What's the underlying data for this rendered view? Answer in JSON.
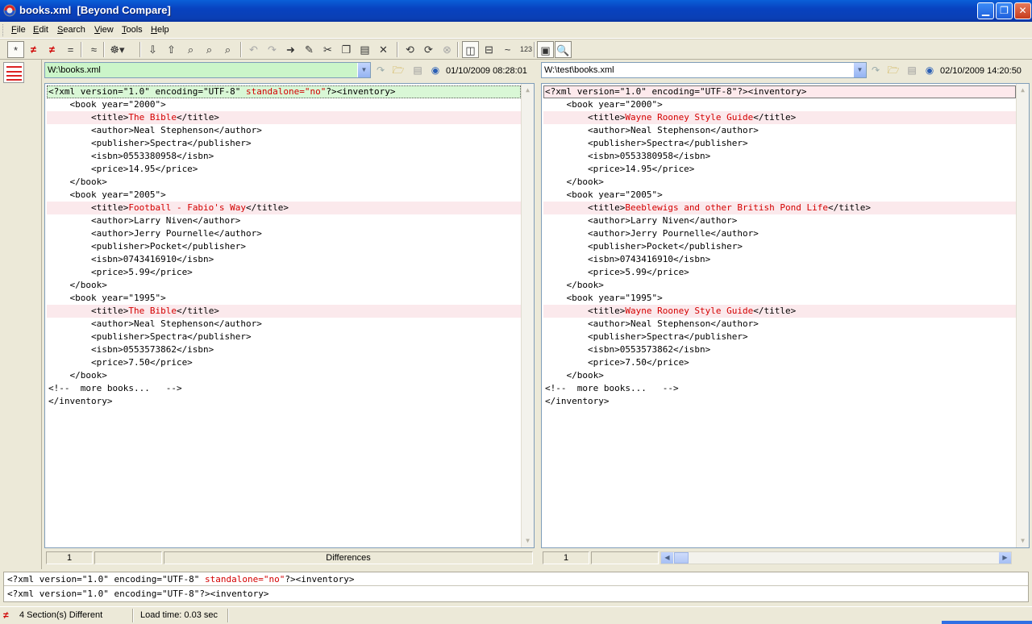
{
  "window": {
    "title": "books.xml  [Beyond Compare]",
    "minimize_glyph": "▁",
    "maximize_glyph": "❐",
    "close_glyph": "✕"
  },
  "menu": [
    "File",
    "Edit",
    "Search",
    "View",
    "Tools",
    "Help"
  ],
  "toolbar": {
    "buttons": [
      {
        "name": "show-all-button",
        "glyph": "*",
        "pressed": true
      },
      {
        "name": "show-differences-button",
        "glyph": "≠",
        "red": true
      },
      {
        "name": "show-diffs-context-button",
        "glyph": "≠",
        "red": true
      },
      {
        "name": "show-same-button",
        "glyph": "="
      },
      {
        "name": "ignore-unimportant-button",
        "glyph": "≈"
      },
      {
        "name": "rules-button",
        "glyph": "☸▾"
      },
      {
        "name": "next-difference-button",
        "glyph": "⇩"
      },
      {
        "name": "prev-difference-button",
        "glyph": "⇧"
      },
      {
        "name": "find-button",
        "glyph": "⌕"
      },
      {
        "name": "find-next-button",
        "glyph": "⌕"
      },
      {
        "name": "find-prev-button",
        "glyph": "⌕"
      },
      {
        "name": "undo-button",
        "glyph": "↶",
        "disabled": true
      },
      {
        "name": "redo-button",
        "glyph": "↷",
        "disabled": true
      },
      {
        "name": "copy-to-other-side-button",
        "glyph": "➜"
      },
      {
        "name": "edit-button",
        "glyph": "✎"
      },
      {
        "name": "cut-button",
        "glyph": "✂"
      },
      {
        "name": "copy-button",
        "glyph": "❐"
      },
      {
        "name": "paste-button",
        "glyph": "▤"
      },
      {
        "name": "delete-button",
        "glyph": "✕"
      },
      {
        "name": "swap-sides-button",
        "glyph": "⟲"
      },
      {
        "name": "refresh-button",
        "glyph": "⟳"
      },
      {
        "name": "stop-button",
        "glyph": "⊗",
        "disabled": true
      },
      {
        "name": "side-by-side-button",
        "glyph": "◫",
        "pressed": true
      },
      {
        "name": "over-under-button",
        "glyph": "⊟"
      },
      {
        "name": "whitespace-button",
        "glyph": "~"
      },
      {
        "name": "line-numbers-button",
        "glyph": "123",
        "small": true
      },
      {
        "name": "thumbnail-button",
        "glyph": "▣",
        "pressed": true
      },
      {
        "name": "zoom-button",
        "glyph": "🔍",
        "pressed": true
      }
    ]
  },
  "left": {
    "path": "W:\\books.xml",
    "timestamp": "01/10/2009 08:28:01",
    "status_line": "1",
    "status_label": "Differences",
    "lines": [
      [
        {
          "t": "<?xml version=\"1.0\" encoding=\"UTF-8\" "
        },
        {
          "t": "standalone=\"no\"",
          "r": true
        },
        {
          "t": "?><inventory>"
        }
      ],
      [
        {
          "t": "    <book year=\"2000\">"
        }
      ],
      [
        {
          "t": "        <title>"
        },
        {
          "t": "The Bible",
          "r": true
        },
        {
          "t": "</title>"
        }
      ],
      [
        {
          "t": "        <author>Neal Stephenson</author>"
        }
      ],
      [
        {
          "t": "        <publisher>Spectra</publisher>"
        }
      ],
      [
        {
          "t": "        <isbn>0553380958</isbn>"
        }
      ],
      [
        {
          "t": "        <price>14.95</price>"
        }
      ],
      [
        {
          "t": "    </book>"
        }
      ],
      [
        {
          "t": "    <book year=\"2005\">"
        }
      ],
      [
        {
          "t": "        <title>"
        },
        {
          "t": "Football - Fabio's Way",
          "r": true
        },
        {
          "t": "</title>"
        }
      ],
      [
        {
          "t": "        <author>Larry Niven</author>"
        }
      ],
      [
        {
          "t": "        <author>Jerry Pournelle</author>"
        }
      ],
      [
        {
          "t": "        <publisher>Pocket</publisher>"
        }
      ],
      [
        {
          "t": "        <isbn>0743416910</isbn>"
        }
      ],
      [
        {
          "t": "        <price>5.99</price>"
        }
      ],
      [
        {
          "t": "    </book>"
        }
      ],
      [
        {
          "t": "    <book year=\"1995\">"
        }
      ],
      [
        {
          "t": "        <title>"
        },
        {
          "t": "The Bible",
          "r": true
        },
        {
          "t": "</title>"
        }
      ],
      [
        {
          "t": "        <author>Neal Stephenson</author>"
        }
      ],
      [
        {
          "t": "        <publisher>Spectra</publisher>"
        }
      ],
      [
        {
          "t": "        <isbn>0553573862</isbn>"
        }
      ],
      [
        {
          "t": "        <price>7.50</price>"
        }
      ],
      [
        {
          "t": "    </book>"
        }
      ],
      [
        {
          "t": "<!--  more books...   -->"
        }
      ],
      [
        {
          "t": "</inventory>"
        }
      ]
    ]
  },
  "right": {
    "path": "W:\\test\\books.xml",
    "timestamp": "02/10/2009 14:20:50",
    "status_line": "1",
    "lines": [
      [
        {
          "t": "<?xml version=\"1.0\" encoding=\"UTF-8\"?><inventory>"
        }
      ],
      [
        {
          "t": "    <book year=\"2000\">"
        }
      ],
      [
        {
          "t": "        <title>"
        },
        {
          "t": "Wayne Rooney Style Guide",
          "r": true
        },
        {
          "t": "</title>"
        }
      ],
      [
        {
          "t": "        <author>Neal Stephenson</author>"
        }
      ],
      [
        {
          "t": "        <publisher>Spectra</publisher>"
        }
      ],
      [
        {
          "t": "        <isbn>0553380958</isbn>"
        }
      ],
      [
        {
          "t": "        <price>14.95</price>"
        }
      ],
      [
        {
          "t": "    </book>"
        }
      ],
      [
        {
          "t": "    <book year=\"2005\">"
        }
      ],
      [
        {
          "t": "        <title>"
        },
        {
          "t": "Beeblewigs and other British Pond Life",
          "r": true
        },
        {
          "t": "</title>"
        }
      ],
      [
        {
          "t": "        <author>Larry Niven</author>"
        }
      ],
      [
        {
          "t": "        <author>Jerry Pournelle</author>"
        }
      ],
      [
        {
          "t": "        <publisher>Pocket</publisher>"
        }
      ],
      [
        {
          "t": "        <isbn>0743416910</isbn>"
        }
      ],
      [
        {
          "t": "        <price>5.99</price>"
        }
      ],
      [
        {
          "t": "    </book>"
        }
      ],
      [
        {
          "t": "    <book year=\"1995\">"
        }
      ],
      [
        {
          "t": "        <title>"
        },
        {
          "t": "Wayne Rooney Style Guide",
          "r": true
        },
        {
          "t": "</title>"
        }
      ],
      [
        {
          "t": "        <author>Neal Stephenson</author>"
        }
      ],
      [
        {
          "t": "        <publisher>Spectra</publisher>"
        }
      ],
      [
        {
          "t": "        <isbn>0553573862</isbn>"
        }
      ],
      [
        {
          "t": "        <price>7.50</price>"
        }
      ],
      [
        {
          "t": "    </book>"
        }
      ],
      [
        {
          "t": "<!--  more books...   -->"
        }
      ],
      [
        {
          "t": "</inventory>"
        }
      ]
    ]
  },
  "diff_rows": [
    0,
    2,
    9,
    17
  ],
  "compare": {
    "line1": [
      {
        "t": "<?xml version=\"1.0\" encoding=\"UTF-8\" "
      },
      {
        "t": "standalone=\"no\"",
        "r": true
      },
      {
        "t": "?><inventory>"
      }
    ],
    "line2": [
      {
        "t": "<?xml version=\"1.0\" encoding=\"UTF-8\"?><inventory>"
      }
    ]
  },
  "status": {
    "sections": "4 Section(s) Different",
    "load_time": "Load time:  0.03 sec"
  },
  "colors": {
    "diff_text": "#d40000",
    "diff_row_bg": "#fbe9ec",
    "current_row_left": "#d9f7d6",
    "path_ok_bg": "#cbf5c9"
  }
}
